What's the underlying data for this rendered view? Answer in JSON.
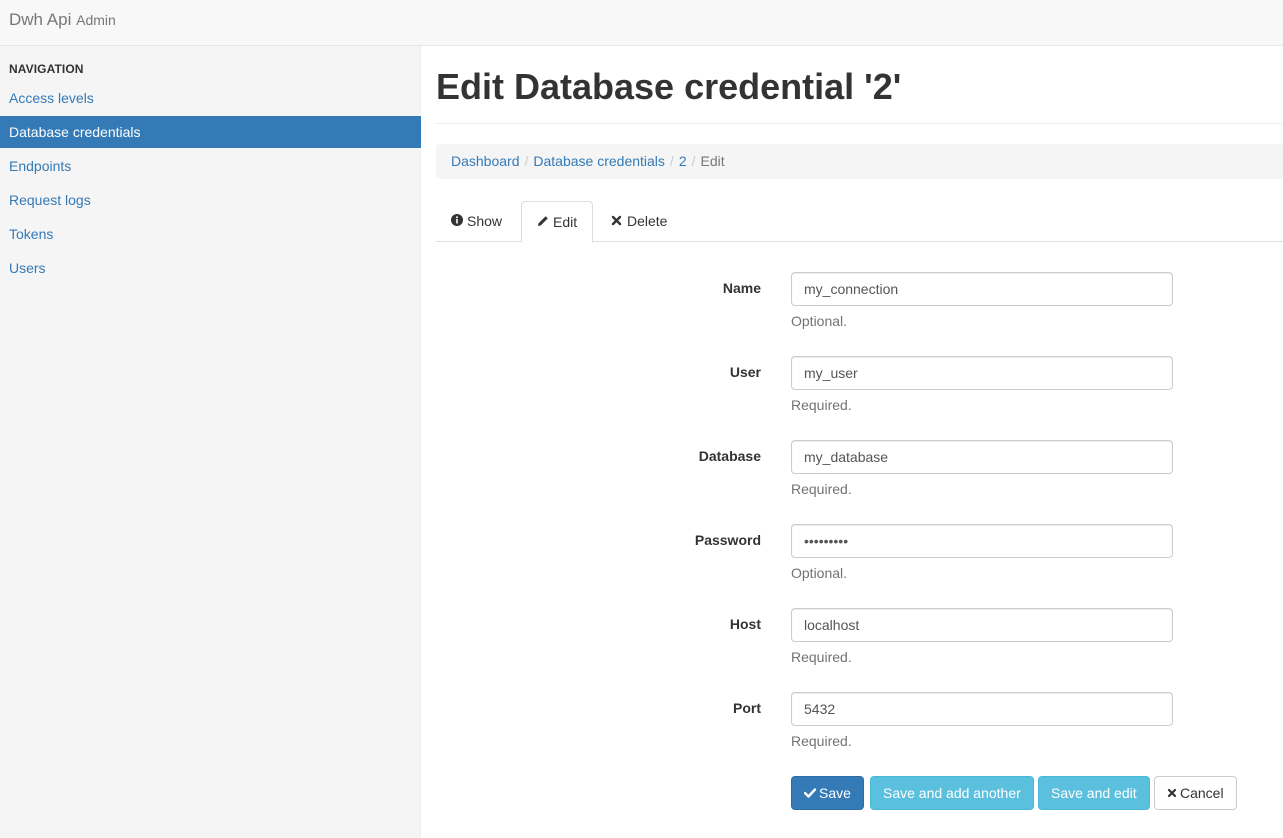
{
  "brand": {
    "name": "Dwh Api",
    "suffix": "Admin"
  },
  "sidebar": {
    "header": "NAVIGATION",
    "items": [
      {
        "label": "Access levels"
      },
      {
        "label": "Database credentials"
      },
      {
        "label": "Endpoints"
      },
      {
        "label": "Request logs"
      },
      {
        "label": "Tokens"
      },
      {
        "label": "Users"
      }
    ]
  },
  "page": {
    "title": "Edit Database credential '2'"
  },
  "breadcrumb": {
    "items": [
      "Dashboard",
      "Database credentials",
      "2"
    ],
    "current": "Edit",
    "separator": "/"
  },
  "tabs": [
    {
      "label": "Show",
      "icon": "info-circle-icon"
    },
    {
      "label": "Edit",
      "icon": "pencil-icon"
    },
    {
      "label": "Delete",
      "icon": "times-icon"
    }
  ],
  "form": {
    "fields": [
      {
        "label": "Name",
        "value": "my_connection",
        "help": "Optional."
      },
      {
        "label": "User",
        "value": "my_user",
        "help": "Required."
      },
      {
        "label": "Database",
        "value": "my_database",
        "help": "Required."
      },
      {
        "label": "Password",
        "value": "password1",
        "help": "Optional."
      },
      {
        "label": "Host",
        "value": "localhost",
        "help": "Required."
      },
      {
        "label": "Port",
        "value": "5432",
        "help": "Required."
      }
    ],
    "buttons": {
      "save": "Save",
      "save_add": "Save and add another",
      "save_edit": "Save and edit",
      "cancel": "Cancel"
    }
  },
  "colors": {
    "primary": "#337ab7",
    "info": "#5bc0de",
    "sidebar_bg": "#f5f5f5"
  }
}
